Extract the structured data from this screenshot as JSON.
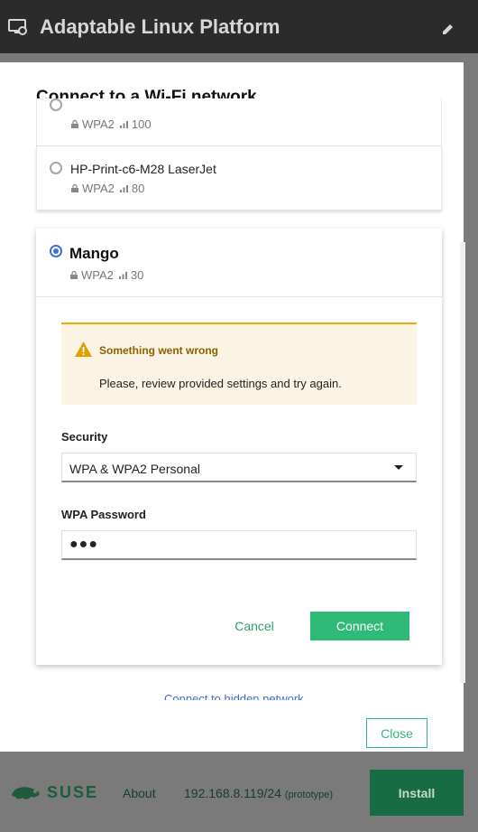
{
  "header": {
    "title": "Adaptable Linux Platform",
    "logo_icon": "monitor-settings-icon",
    "edit_icon": "pencil-icon"
  },
  "dialog": {
    "title": "Connect to a Wi-Fi network",
    "networks": [
      {
        "name": "",
        "security": "WPA2",
        "signal": "100"
      },
      {
        "name": "HP-Print-c6-M28 LaserJet",
        "security": "WPA2",
        "signal": "80"
      },
      {
        "name": "Mango",
        "security": "WPA2",
        "signal": "30",
        "selected": true
      }
    ],
    "alert": {
      "title": "Something went wrong",
      "body": "Please, review provided settings and try again."
    },
    "security_label": "Security",
    "security_value": "WPA & WPA2 Personal",
    "password_label": "WPA Password",
    "password_value": "●●●",
    "cancel_label": "Cancel",
    "connect_label": "Connect",
    "hidden_network_link": "Connect to hidden network",
    "close_label": "Close"
  },
  "footer": {
    "brand": "SUSE",
    "about_label": "About",
    "ip": "192.168.8.119/24",
    "ip_note": "(prototype)",
    "install_label": "Install"
  },
  "colors": {
    "accent": "#30ba78",
    "accent_dark": "#186c44",
    "link": "#3e6fd8",
    "warning": "#f2a900",
    "header_bg": "#2b2b2b",
    "overlay": "#7a7a7a"
  }
}
